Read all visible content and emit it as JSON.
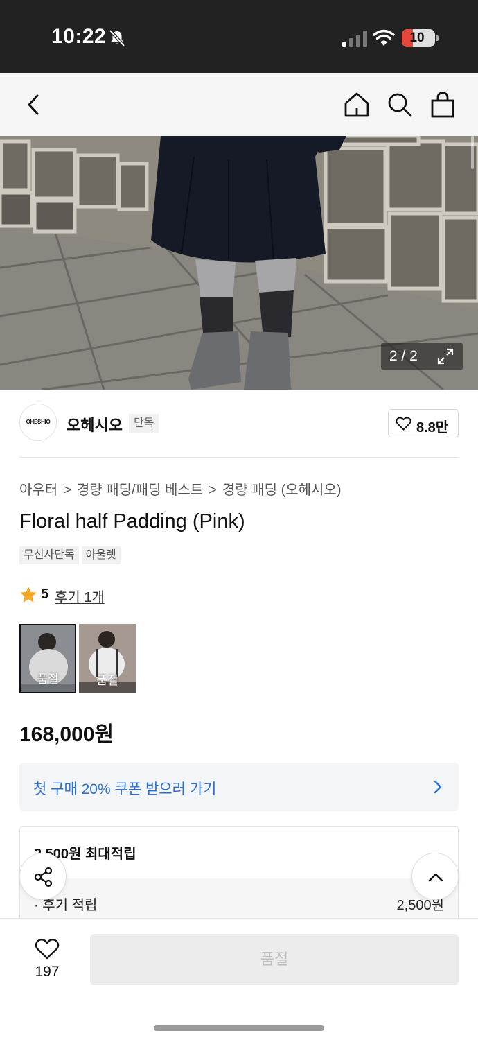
{
  "status_bar": {
    "time": "10:22",
    "battery": "10",
    "bell_icon": "bell-slash-icon"
  },
  "header": {
    "icons": [
      "back-icon",
      "home-icon",
      "search-icon",
      "shopping-bag-icon"
    ]
  },
  "photo": {
    "counter": "2 / 2",
    "expand_icon": "expand-icon"
  },
  "brand": {
    "logo_text": "OHESHIO",
    "name": "오헤시오",
    "badge": "단독",
    "likes": "8.8만"
  },
  "breadcrumb": [
    "아우터",
    "경량 패딩/패딩 베스트",
    "경량 패딩 (오헤시오)"
  ],
  "product": {
    "title": "Floral half Padding (Pink)",
    "tags": [
      "무신사단독",
      "아울렛"
    ],
    "rating": "5",
    "review_link": "후기 1개",
    "thumbnails": [
      {
        "label": "품절"
      },
      {
        "label": "품절"
      }
    ],
    "price": "168,000원"
  },
  "coupon": {
    "text": "첫 구매 20% 쿠폰 받으러 가기"
  },
  "points": {
    "title": "2,500원 최대적립",
    "row_label": "· 후기 적립",
    "row_value": "2,500원"
  },
  "bottom": {
    "wish_count": "197",
    "buy_label": "품절"
  },
  "colors": {
    "accent_blue": "#2b6fd6",
    "star": "#f5a623",
    "status_bar_bg": "#222222"
  }
}
